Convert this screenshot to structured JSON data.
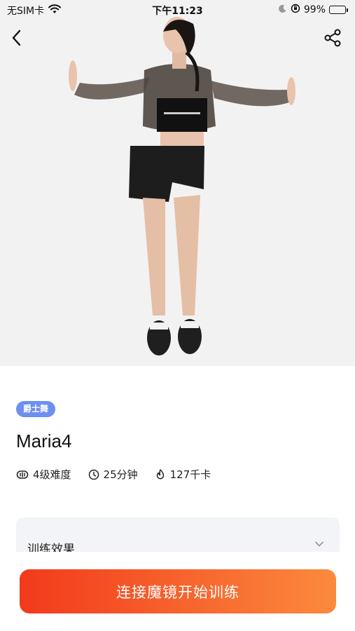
{
  "status_bar": {
    "carrier": "无SIM卡",
    "time": "下午11:23",
    "battery_percent": "99%",
    "battery_level": 0.99,
    "icons": [
      "wifi-icon",
      "moon-icon",
      "orientation-lock-icon",
      "battery-icon"
    ]
  },
  "nav": {
    "back_icon": "chevron-left-icon",
    "share_icon": "share-icon"
  },
  "course": {
    "tag": "爵士舞",
    "title": "Maria4",
    "difficulty": "4级难度",
    "duration": "25分钟",
    "calories": "127千卡",
    "tag_color": "#6c8ff0"
  },
  "effect_section": {
    "label": "训练效果"
  },
  "cta": {
    "label": "连接魔镜开始训练",
    "gradient_start": "#f23a1c",
    "gradient_end": "#fb8a3d"
  }
}
